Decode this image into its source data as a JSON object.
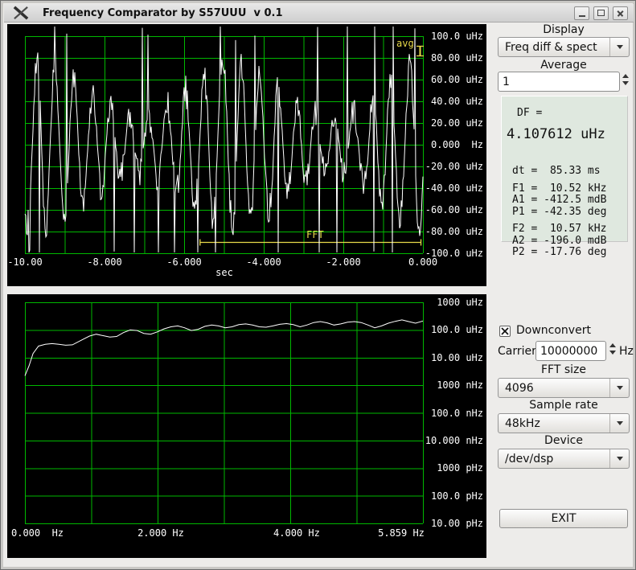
{
  "window": {
    "title": "Frequency Comparator by S57UUU  v 0.1"
  },
  "right_panel": {
    "display": {
      "label": "Display",
      "value": "Freq diff & spect"
    },
    "average": {
      "label": "Average",
      "value": "1"
    },
    "readout": {
      "df_label": "DF =",
      "df_value": "4.107612 uHz",
      "groups": [
        [
          "dt =  85.33 ms"
        ],
        [
          "F1 =  10.52 kHz",
          "A1 = -412.5 mdB",
          "P1 = -42.35 deg"
        ],
        [
          "F2 =  10.57 kHz",
          "A2 = -196.0 mdB",
          "P2 = -17.76 deg"
        ]
      ]
    },
    "downconvert": {
      "label": "Downconvert",
      "checked": true
    },
    "carrier": {
      "label": "Carrier",
      "value": "10000000",
      "unit": "Hz"
    },
    "fft_size": {
      "label": "FFT size",
      "value": "4096"
    },
    "sample_rate": {
      "label": "Sample rate",
      "value": "48kHz"
    },
    "device": {
      "label": "Device",
      "value": "/dev/dsp"
    },
    "exit_button": "EXIT"
  },
  "chart_data": [
    {
      "type": "line",
      "title": "frequency difference vs time",
      "xlabel": "sec",
      "x_ticks": [
        "-10.00",
        "-8.000",
        "-6.000",
        "-4.000",
        "-2.000",
        "0.000"
      ],
      "y_ticks": [
        "100.0 uHz",
        "80.00 uHz",
        "60.00 uHz",
        "40.00 uHz",
        "20.00 uHz",
        "0.000  Hz",
        "-20.00 uHz",
        "-40.00 uHz",
        "-60.00 uHz",
        "-80.00 uHz",
        "-100.0 uHz"
      ],
      "x_range_sec": [
        -10,
        0
      ],
      "y_range_uHz": [
        -100,
        100
      ],
      "grid": true,
      "legend_position": "none",
      "colors": {
        "grid": "#00b800",
        "trace": "#ffffff",
        "marker": "#e8d94a"
      },
      "annotations": {
        "avg_label": "avg",
        "fft_label": "FFT",
        "fft_span_sec": [
          -5.6,
          -0.05
        ],
        "fft_level_uHz": -90
      },
      "series_generator": {
        "seed": 42,
        "points": 496,
        "phase_base": 0.2,
        "phase_jitter": 0.14,
        "amp_base": 50,
        "amp_mod": 25,
        "amp_rate": 1.3,
        "amp_phase": 1.0,
        "amp_jitter": 30,
        "spike_prob": 0.05,
        "spike_base": 95,
        "spike_var": 35
      }
    },
    {
      "type": "line",
      "title": "frequency difference spectrum",
      "y_scale": "log",
      "x_ticks": [
        {
          "label": "0.000  Hz",
          "hz": 0
        },
        {
          "label": "2.000 Hz",
          "hz": 2.0
        },
        {
          "label": "4.000 Hz",
          "hz": 4.0
        },
        {
          "label": "5.859 Hz",
          "hz": 5.859
        }
      ],
      "y_ticks": [
        "1000 uHz",
        "100.0 uHz",
        "10.00 uHz",
        "1000 nHz",
        "100.0 nHz",
        "10.000 nHz",
        "1000 pHz",
        "100.0 pHz",
        "10.00 pHz"
      ],
      "x_range_hz": [
        0,
        5.859
      ],
      "y_range": [
        "10 pHz",
        "1000 uHz"
      ],
      "y_decades": 8,
      "grid": true,
      "colors": {
        "grid": "#00b800",
        "trace": "#ffffff"
      },
      "points_hz_uHz": [
        [
          0.0,
          2.2
        ],
        [
          0.06,
          5
        ],
        [
          0.12,
          14
        ],
        [
          0.2,
          26
        ],
        [
          0.3,
          30
        ],
        [
          0.4,
          32
        ],
        [
          0.5,
          30
        ],
        [
          0.6,
          28
        ],
        [
          0.7,
          29
        ],
        [
          0.85,
          45
        ],
        [
          0.95,
          60
        ],
        [
          1.05,
          70
        ],
        [
          1.15,
          62
        ],
        [
          1.25,
          55
        ],
        [
          1.35,
          58
        ],
        [
          1.45,
          80
        ],
        [
          1.55,
          100
        ],
        [
          1.65,
          95
        ],
        [
          1.75,
          75
        ],
        [
          1.85,
          70
        ],
        [
          1.95,
          85
        ],
        [
          2.05,
          110
        ],
        [
          2.15,
          130
        ],
        [
          2.25,
          140
        ],
        [
          2.35,
          120
        ],
        [
          2.45,
          95
        ],
        [
          2.55,
          105
        ],
        [
          2.65,
          135
        ],
        [
          2.75,
          150
        ],
        [
          2.85,
          140
        ],
        [
          2.95,
          120
        ],
        [
          3.05,
          130
        ],
        [
          3.15,
          155
        ],
        [
          3.25,
          165
        ],
        [
          3.35,
          150
        ],
        [
          3.45,
          130
        ],
        [
          3.55,
          125
        ],
        [
          3.65,
          140
        ],
        [
          3.75,
          160
        ],
        [
          3.85,
          170
        ],
        [
          3.95,
          155
        ],
        [
          4.05,
          130
        ],
        [
          4.15,
          150
        ],
        [
          4.25,
          185
        ],
        [
          4.35,
          200
        ],
        [
          4.45,
          180
        ],
        [
          4.55,
          150
        ],
        [
          4.65,
          165
        ],
        [
          4.75,
          190
        ],
        [
          4.85,
          200
        ],
        [
          4.95,
          185
        ],
        [
          5.05,
          150
        ],
        [
          5.15,
          120
        ],
        [
          5.25,
          140
        ],
        [
          5.35,
          175
        ],
        [
          5.45,
          205
        ],
        [
          5.55,
          230
        ],
        [
          5.65,
          200
        ],
        [
          5.75,
          175
        ],
        [
          5.859,
          210
        ]
      ]
    }
  ]
}
